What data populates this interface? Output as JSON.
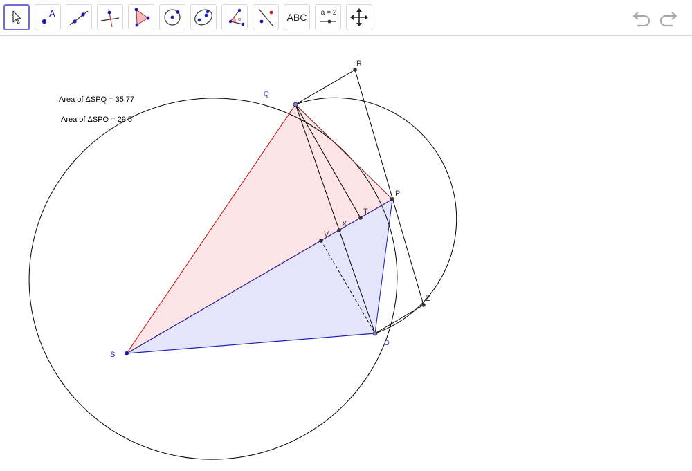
{
  "toolbar": {
    "tools": [
      {
        "name": "move-tool",
        "icon": "pointer-arrow-icon",
        "selected": true
      },
      {
        "name": "point-tool",
        "icon": "point-A-icon",
        "label": "A"
      },
      {
        "name": "line-tool",
        "icon": "line-through-points-icon"
      },
      {
        "name": "perpendicular-tool",
        "icon": "perpendicular-line-icon"
      },
      {
        "name": "polygon-tool",
        "icon": "polygon-icon"
      },
      {
        "name": "circle-tool",
        "icon": "circle-center-point-icon"
      },
      {
        "name": "conic-tool",
        "icon": "ellipse-icon"
      },
      {
        "name": "angle-tool",
        "icon": "angle-icon"
      },
      {
        "name": "reflect-tool",
        "icon": "reflect-about-line-icon"
      },
      {
        "name": "text-tool",
        "icon": "text-icon",
        "label": "ABC"
      },
      {
        "name": "slider-tool",
        "icon": "slider-icon",
        "label": "a = 2"
      },
      {
        "name": "move-graphics-tool",
        "icon": "move-graphics-view-icon"
      }
    ],
    "undo_icon": "undo-icon",
    "redo_icon": "redo-icon"
  },
  "texts": {
    "area_spq": "Area of ΔSPQ = 35.77",
    "area_spo": "Area of ΔSPO = 29.5"
  },
  "labels": {
    "R": "R",
    "Q": "Q",
    "P": "P",
    "T": "T",
    "X": "X",
    "V": "V",
    "S": "S",
    "O": "O",
    "Z": "Z"
  },
  "colors": {
    "accent": "#6d6de0",
    "point_blue": "#1a1ab3",
    "point_dark": "#333333",
    "triangle_spq_fill": "#fde4e6",
    "triangle_spq_edge": "#cc0000",
    "triangle_spo_fill": "#e4e5fb",
    "triangle_spo_edge": "#1a1ab3",
    "label_blue": "#4646d6"
  }
}
